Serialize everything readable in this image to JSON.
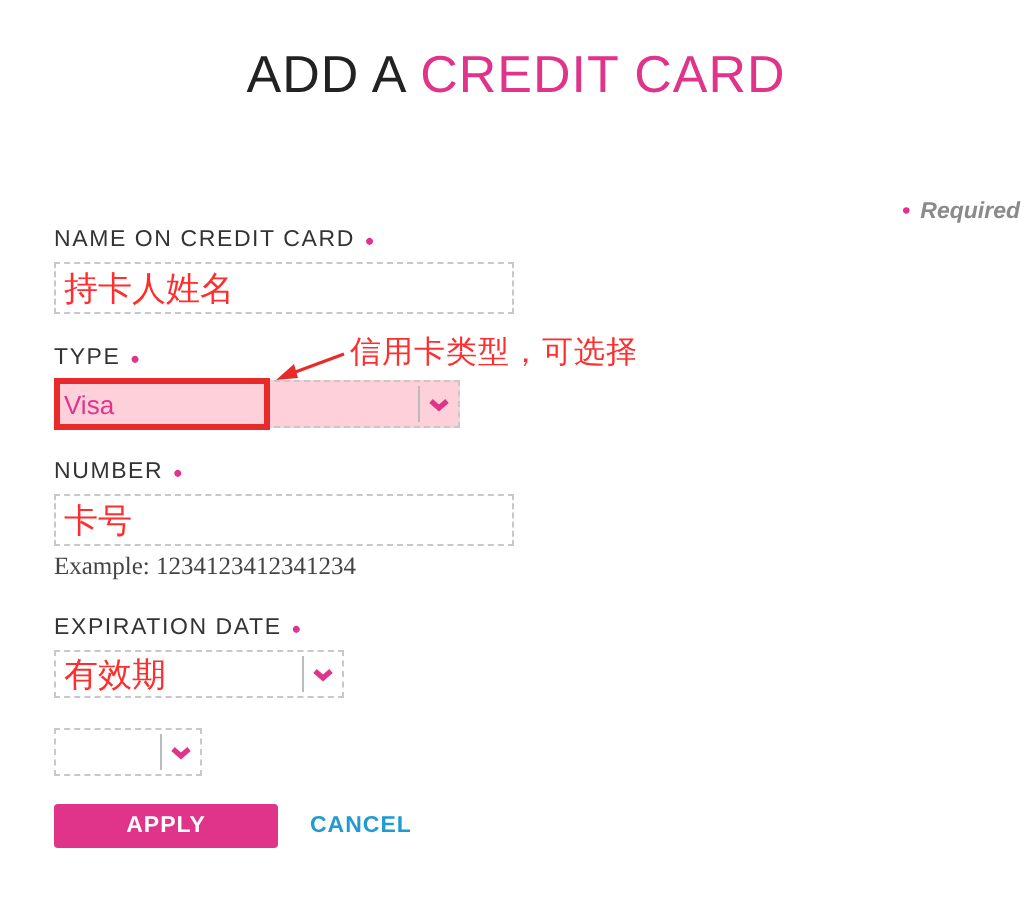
{
  "title": {
    "text": "ADD A",
    "highlight": "CREDIT CARD"
  },
  "required_note": {
    "mark": "•",
    "text": "Required"
  },
  "fields": [
    {
      "kind": "text",
      "label": "NAME ON CREDIT CARD",
      "required_mark": "•",
      "value": "持卡人姓名"
    },
    {
      "kind": "select",
      "label": "TYPE",
      "required_mark": "•",
      "value": "Visa",
      "highlighted": true,
      "annotation": "信用卡类型，可选择"
    },
    {
      "kind": "text",
      "label": "NUMBER",
      "required_mark": "•",
      "value": "卡号",
      "hint": "Example: 1234123412341234"
    },
    {
      "kind": "date",
      "label": "EXPIRATION DATE",
      "required_mark": "•",
      "value": "有效期"
    }
  ],
  "buttons": [
    {
      "kind": "primary",
      "label": "APPLY"
    },
    {
      "kind": "link",
      "label": "CANCEL"
    }
  ]
}
